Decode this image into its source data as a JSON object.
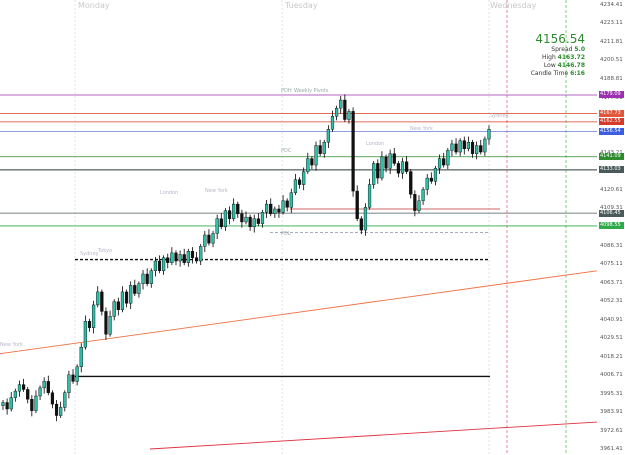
{
  "days": [
    "Monday",
    "Tuesday",
    "Wednesday"
  ],
  "sessions": [
    "New York",
    "London",
    "New York",
    "Sydney",
    "Tokyo",
    "London",
    "New York",
    "Sydney",
    "London",
    "New York",
    "Sydney"
  ],
  "level_labels": [
    "PDH",
    "Weekly Pivots",
    "PDC",
    "PDL"
  ],
  "info": {
    "price": "4156.54",
    "spread_label": "Spread",
    "spread": "5.0",
    "high_label": "High",
    "high": "4163.72",
    "low_label": "Low",
    "low": "4146.78",
    "candle_label": "Candle Time",
    "candle": "6:16"
  },
  "axis_ticks": [
    "4234.41",
    "4223.11",
    "4211.81",
    "4200.51",
    "4188.81",
    "4177.51",
    "4166.21",
    "4154.91",
    "4143.21",
    "4131.91",
    "4120.61",
    "4109.31",
    "4097.61",
    "4086.31",
    "4075.11",
    "4063.71",
    "4052.31",
    "4040.91",
    "4029.51",
    "4018.21",
    "4006.71",
    "3995.31",
    "3983.91",
    "3972.61",
    "3961.41"
  ],
  "price_tags": [
    {
      "text": "4179.09",
      "color": "#9b30b0"
    },
    {
      "text": "4167.73",
      "color": "#e0553c"
    },
    {
      "text": "4162.55",
      "color": "#d83a2a"
    },
    {
      "text": "4156.54",
      "color": "#3c5ee0"
    },
    {
      "text": "4141.09",
      "color": "#2e8b2e"
    },
    {
      "text": "4133.03",
      "color": "#4a5a5a"
    },
    {
      "text": "4106.45",
      "color": "#4a5a5a"
    },
    {
      "text": "4098.55",
      "color": "#2eaa4a"
    }
  ],
  "chart_data": {
    "type": "candlestick",
    "symbol_note": "",
    "ylim": [
      3961.41,
      4234.41
    ],
    "closes": [
      3990,
      3986,
      3993,
      3997,
      4001,
      3998,
      3992,
      3985,
      3994,
      3999,
      4003,
      3996,
      3989,
      3982,
      3987,
      3996,
      4007,
      4003,
      4012,
      4024,
      4040,
      4036,
      4050,
      4058,
      4046,
      4032,
      4043,
      4052,
      4047,
      4058,
      4051,
      4062,
      4057,
      4063,
      4069,
      4063,
      4071,
      4077,
      4071,
      4079,
      4076,
      4082,
      4077,
      4081,
      4076,
      4083,
      4079,
      4077,
      4086,
      4093,
      4088,
      4094,
      4103,
      4098,
      4108,
      4103,
      4112,
      4106,
      4101,
      4104,
      4098,
      4103,
      4100,
      4107,
      4112,
      4106,
      4109,
      4107,
      4114,
      4110,
      4119,
      4127,
      4124,
      4132,
      4140,
      4136,
      4148,
      4143,
      4150,
      4158,
      4166,
      4171,
      4176,
      4164,
      4169,
      4120,
      4103,
      4096,
      4110,
      4124,
      4137,
      4128,
      4141,
      4134,
      4143,
      4137,
      4131,
      4138,
      4132,
      4118,
      4108,
      4114,
      4121,
      4128,
      4126,
      4134,
      4140,
      4136,
      4145,
      4149,
      4144,
      4151,
      4146,
      4150,
      4143,
      4148,
      4144,
      4152,
      4158
    ]
  }
}
